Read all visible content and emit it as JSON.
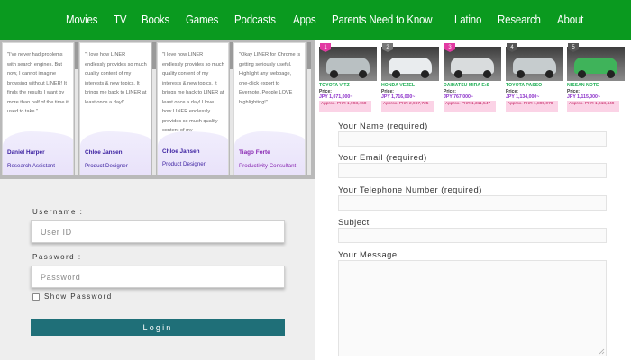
{
  "nav": {
    "items": [
      "Movies",
      "TV",
      "Books",
      "Games",
      "Podcasts",
      "Apps",
      "Parents Need to Know",
      "Latino",
      "Research",
      "About"
    ]
  },
  "testimonials": [
    {
      "text": "\"I've never had problems with search engines. But now, I cannot imagine browsing without LINER! It finds the results I want by more than half of the time it used to take.\"",
      "name": "Daniel Harper",
      "role": "Research Assistant"
    },
    {
      "text": "\"I love how LINER endlessly provides so much quality content of my interests & new topics. It brings me back to LINER at least once a day!\"",
      "name": "Chloe Jansen",
      "role": "Product Designer"
    },
    {
      "text": "\"I love how LINER endlessly provides so much quality content of my interests & new topics. It brings me back to LINER at least once a day! I love how LINER endlessly provides so much quality content of my",
      "name": "Chloe Jansen",
      "role": "Product Designer"
    },
    {
      "text": "\"Okay LINER for Chrome is getting seriously useful. Highlight any webpage, one-click export to Evernote. People LOVE highlighting!\"",
      "name": "Tiago Forte",
      "role": "Productivity Consultant"
    }
  ],
  "login": {
    "username_label": "Username :",
    "username_placeholder": "User ID",
    "password_label": "Password :",
    "password_placeholder": "Password",
    "show_password": "Show Password",
    "login_button": "Login"
  },
  "cars": [
    {
      "rank": "1",
      "model": "TOYOTA VITZ",
      "price_label": "Price:",
      "price": "JPY 1,071,000~",
      "approx": "Approx. PKR 1,993,460~",
      "body_color": "#b9c0c2",
      "badge_color": "#e23aa3"
    },
    {
      "rank": "2",
      "model": "HONDA VEZEL",
      "price_label": "Price:",
      "price": "JPY 1,716,000~",
      "approx": "Approx. PKR 2,967,725~",
      "body_color": "#e9ecee",
      "badge_color": "#777777"
    },
    {
      "rank": "3",
      "model": "DAIHATSU MIRA E:S",
      "price_label": "Price:",
      "price": "JPY 767,000~",
      "approx": "Approx. PKR 1,311,547~",
      "body_color": "#d9dcdd",
      "badge_color": "#e23aa3"
    },
    {
      "rank": "4",
      "model": "TOYOTA PASSO",
      "price_label": "Price:",
      "price": "JPY 1,134,000~",
      "approx": "Approx. PKR 1,895,078~",
      "body_color": "#c6ccce",
      "badge_color": "#555555"
    },
    {
      "rank": "5",
      "model": "NISSAN NOTE",
      "price_label": "Price:",
      "price": "JPY 1,115,000~",
      "approx": "Approx. PKR 1,618,449~",
      "body_color": "#3fb35a",
      "badge_color": "#555555"
    }
  ],
  "form": {
    "name_label": "Your Name (required)",
    "email_label": "Your Email (required)",
    "phone_label": "Your Telephone Number (required)",
    "subject_label": "Subject",
    "message_label": "Your Message"
  },
  "colors": {
    "nav_bg": "#0a9a1f",
    "login_button": "#1f6f78",
    "testimonial_accent": "#3b1fa0",
    "car_price": "#8b2fc9"
  }
}
